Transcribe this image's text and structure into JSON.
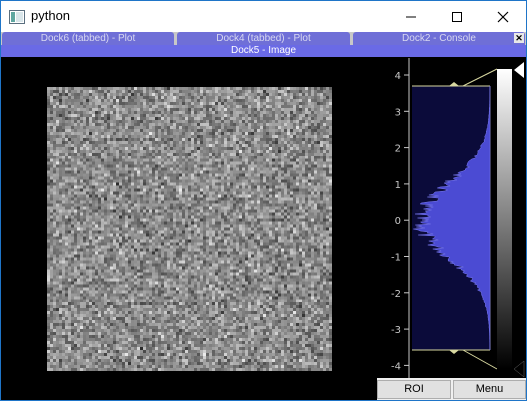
{
  "window": {
    "title": "python",
    "app_icon": "python-window-icon"
  },
  "controls": {
    "minimize_icon": "minimize-icon",
    "maximize_icon": "maximize-icon",
    "close_icon": "close-icon"
  },
  "tabs": [
    {
      "label": "Dock6 (tabbed) - Plot"
    },
    {
      "label": "Dock4 (tabbed) - Plot"
    },
    {
      "label": "Dock2 - Console",
      "close_icon": "close-icon"
    }
  ],
  "dock": {
    "title": "Dock5 - Image"
  },
  "histogram": {
    "ticks": [
      "4",
      "3",
      "2",
      "1",
      "0",
      "-1",
      "-2",
      "-3",
      "-4"
    ],
    "level_max": 3.7,
    "level_min": -3.7,
    "fill_color": "#4b4bd3",
    "region_color": "#0b0b3a"
  },
  "buttons": {
    "roi": "ROI",
    "menu": "Menu"
  }
}
